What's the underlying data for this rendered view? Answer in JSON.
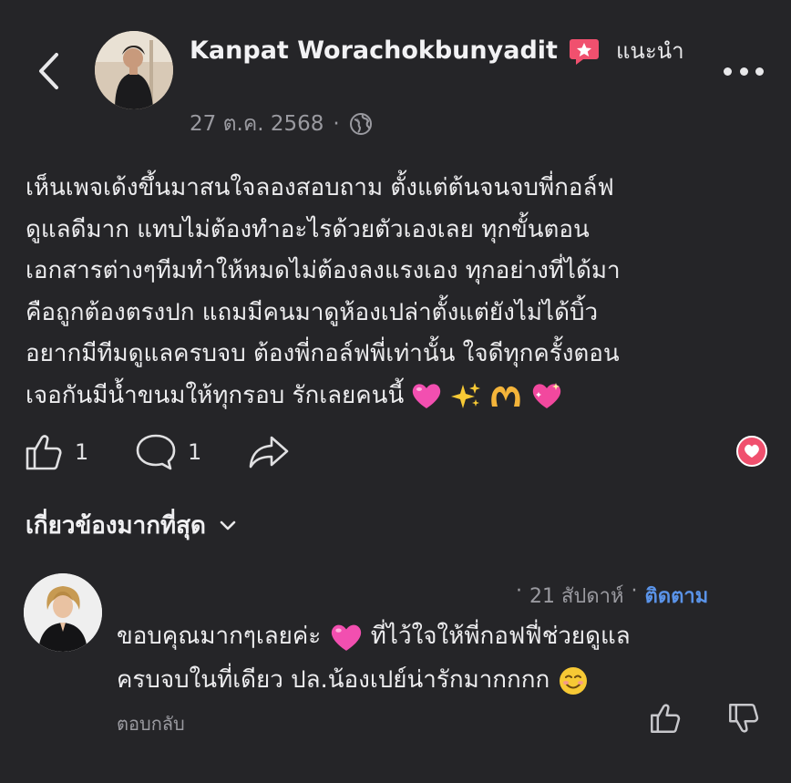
{
  "header": {
    "author_name": "Kanpat Worachokbunyadit",
    "badge_icon": "star-recommend-icon",
    "recommend_label": "แนะนำ",
    "date": "27 ต.ค. 2568",
    "separator": "·",
    "privacy_icon": "globe-icon"
  },
  "post": {
    "lines": [
      "เห็นเพจเด้งขึ้นมาสนใจลองสอบถาม ตั้งแต่ต้นจนจบพี่กอล์ฟ",
      "ดูแลดีมาก แทบไม่ต้องทำอะไรด้วยตัวเองเลย ทุกขั้นตอน",
      "เอกสารต่างๆทีมทำให้หมดไม่ต้องลงแรงเอง ทุกอย่างที่ได้มา",
      "คือถูกต้องตรงปก แถมมีคนมาดูห้องเปล่าตั้งแต่ยังไม่ได้บิ้ว",
      "อยากมีทีมดูแลครบจบ ต้องพี่กอล์ฟพี่เท่านั้น ใจดีทุกครั้งตอน",
      "เจอกันมีน้ำขนมให้ทุกรอบ รักเลยคนนี้"
    ],
    "emojis": [
      "pink-heart-icon",
      "sparkles-icon",
      "heart-hands-icon",
      "sparkling-heart-icon"
    ]
  },
  "actions": {
    "like_count": "1",
    "comment_count": "1",
    "reaction_icon": "love-reaction-icon"
  },
  "sort": {
    "label": "เกี่ยวข้องมากที่สุด"
  },
  "comment": {
    "prefix": "·",
    "time": "21 สัปดาห์",
    "separator": "·",
    "follow_label": "ติดตาม",
    "line1_a": "ขอบคุณมากๆเลยค่ะ",
    "line1_b": "ที่ไว้ใจให้พี่กอฟฟี่ช่วยดูแล",
    "line2": "ครบจบในที่เดียว ปล.น้องเปย์น่ารักมากกกก",
    "emojis": [
      "pink-heart-icon",
      "smiling-face-icon"
    ],
    "reply_label": "ตอบกลับ"
  },
  "colors": {
    "background": "#252528",
    "link": "#5a93e8",
    "love": "#f0506e"
  }
}
